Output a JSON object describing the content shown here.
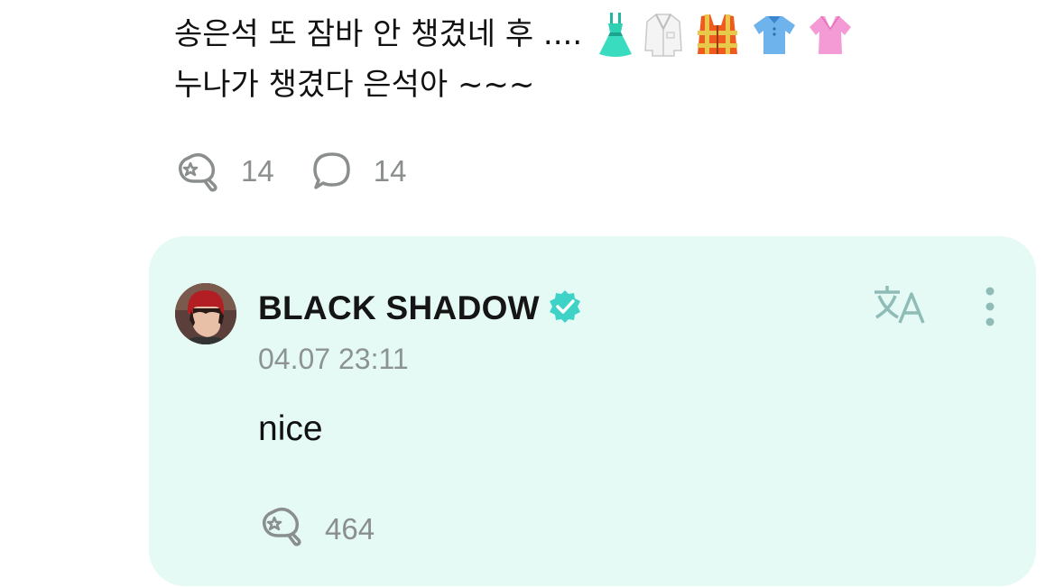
{
  "post": {
    "text_line1": "송은석 또 잠바 안 챙겼네 후 ....",
    "text_line2": "누나가 챙겼다 은석아 ~~~",
    "emojis": [
      "dress-icon",
      "lab-coat-icon",
      "safety-vest-icon",
      "tshirt-icon",
      "blouse-icon"
    ],
    "like_count": "14",
    "comment_count": "14"
  },
  "comment": {
    "author": "BLACK SHADOW",
    "verified_icon": "verified-badge-icon",
    "timestamp": "04.07 23:11",
    "text": "nice",
    "like_count": "464",
    "translate_icon": "translate-icon",
    "more_icon": "more-vertical-icon"
  },
  "colors": {
    "card_bg": "#e5faf5",
    "verified": "#3fd3c7",
    "muted": "#8a8f8e",
    "icon_outline": "#8fbcb6"
  }
}
